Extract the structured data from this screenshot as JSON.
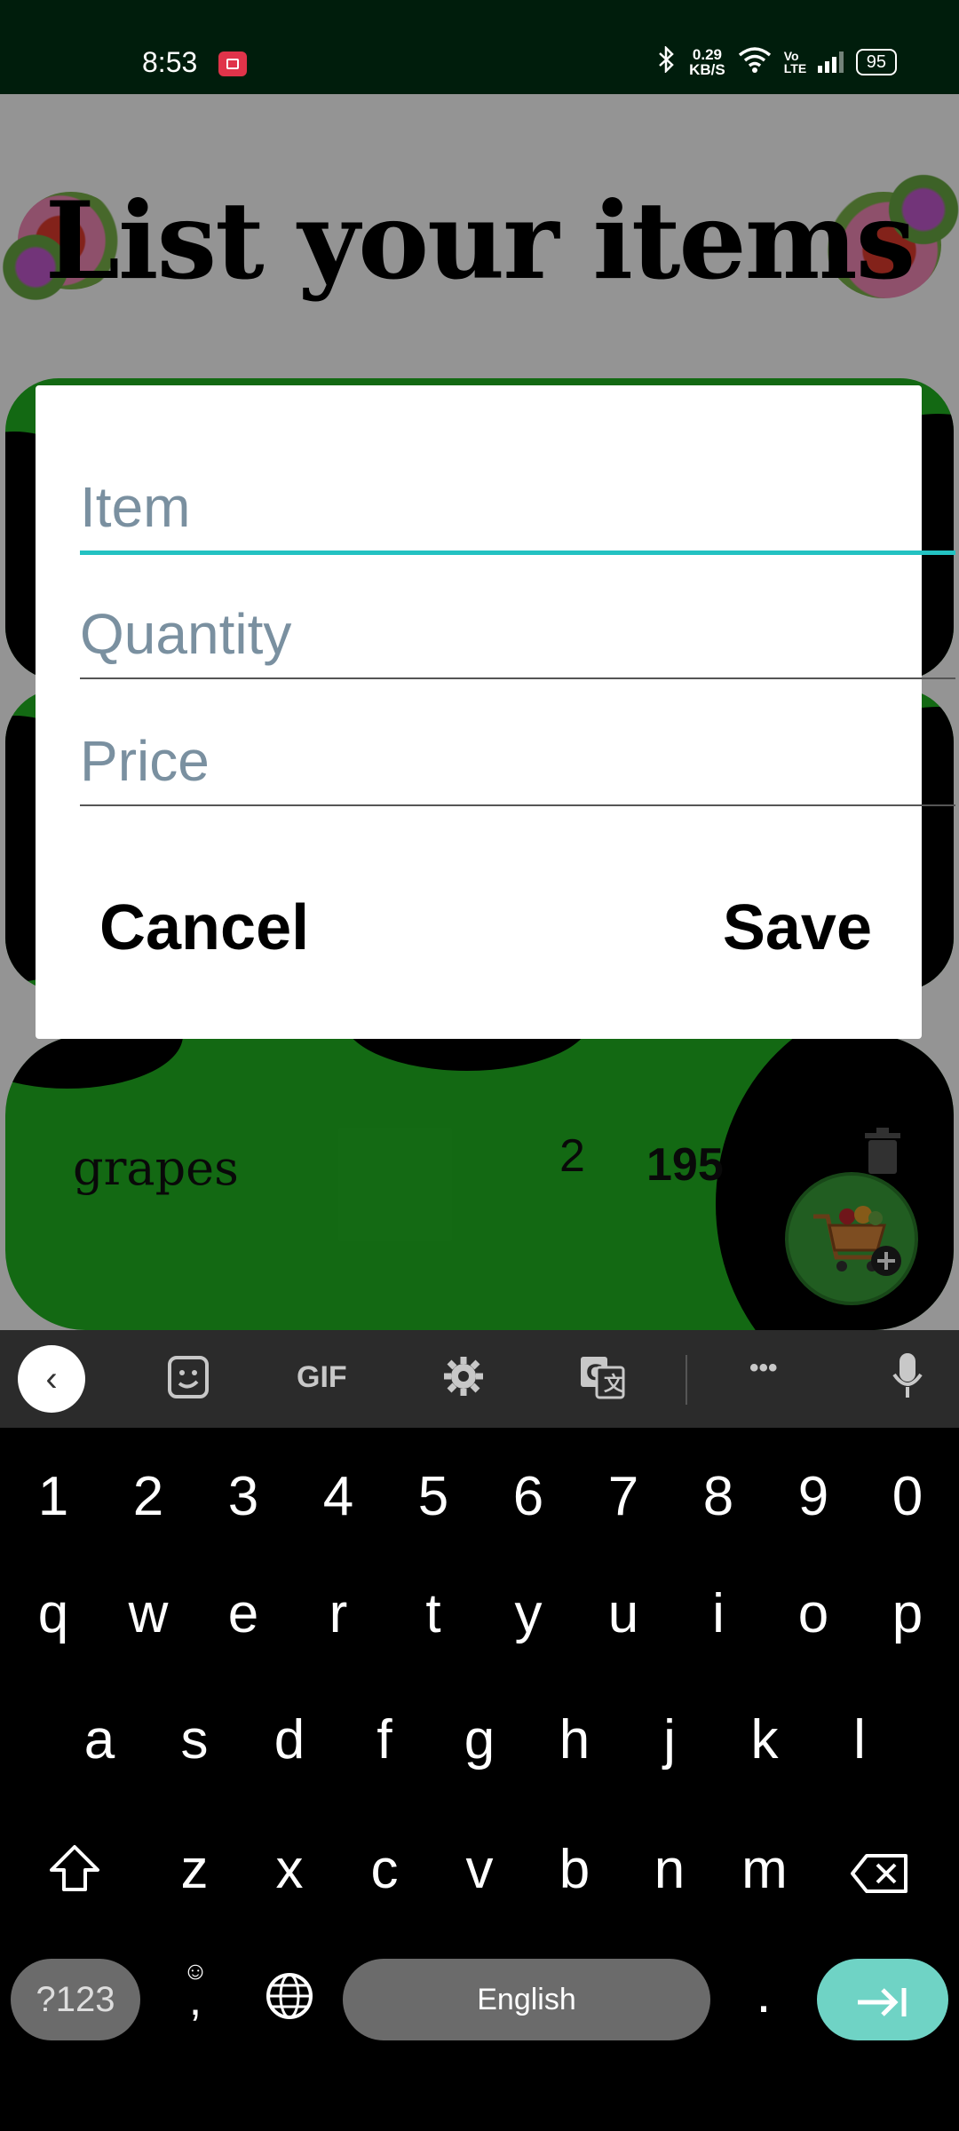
{
  "status_bar": {
    "time": "8:53",
    "net_speed_value": "0.29",
    "net_speed_unit": "KB/S",
    "volte": "Vo LTE",
    "battery": "95"
  },
  "app": {
    "header_title": "List your items",
    "item": {
      "name": "grapes",
      "quantity": "2",
      "price": "195"
    }
  },
  "dialog": {
    "fields": {
      "item": {
        "placeholder": "Item",
        "value": ""
      },
      "quantity": {
        "placeholder": "Quantity",
        "value": ""
      },
      "price": {
        "placeholder": "Price",
        "value": ""
      }
    },
    "cancel_label": "Cancel",
    "save_label": "Save"
  },
  "keyboard": {
    "toolbar": {
      "gif_label": "GIF",
      "more_label": "•••"
    },
    "row_numbers": [
      "1",
      "2",
      "3",
      "4",
      "5",
      "6",
      "7",
      "8",
      "9",
      "0"
    ],
    "row_top": [
      "q",
      "w",
      "e",
      "r",
      "t",
      "y",
      "u",
      "i",
      "o",
      "p"
    ],
    "row_middle": [
      "a",
      "s",
      "d",
      "f",
      "g",
      "h",
      "j",
      "k",
      "l"
    ],
    "row_bottom": [
      "z",
      "x",
      "c",
      "v",
      "b",
      "n",
      "m"
    ],
    "symbols_label": "?123",
    "comma_label": ",",
    "space_label": "English",
    "period_label": ".",
    "accent_color": "#6fd3c5"
  },
  "colors": {
    "field_focus": "#23c2c2",
    "card_green": "#22b622",
    "status_bar": "#001d0c"
  }
}
